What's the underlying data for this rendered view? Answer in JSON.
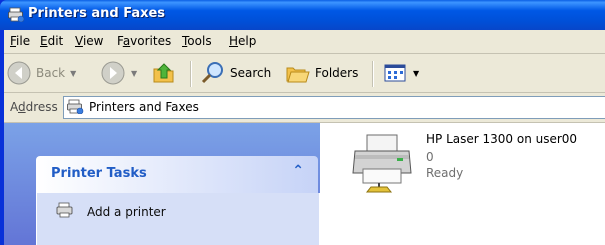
{
  "window": {
    "title": "Printers and Faxes"
  },
  "menu": [
    {
      "key": "F",
      "rest": "ile"
    },
    {
      "key": "E",
      "rest": "dit"
    },
    {
      "key": "V",
      "rest": "iew"
    },
    {
      "pre": "F",
      "key": "a",
      "rest": "vorites"
    },
    {
      "key": "T",
      "rest": "ools"
    },
    {
      "key": "H",
      "rest": "elp"
    }
  ],
  "toolbar": {
    "back_label": "Back",
    "search_label": "Search",
    "folders_label": "Folders"
  },
  "address": {
    "label_pre": "A",
    "label_key": "d",
    "label_rest": "dress",
    "value": "Printers and Faxes"
  },
  "tasks": {
    "title": "Printer Tasks",
    "chevron": "⌃",
    "items": [
      "Add a printer"
    ]
  },
  "printer": {
    "name": "HP Laser 1300 on user00",
    "jobs": "0",
    "status": "Ready"
  },
  "colors": {
    "title_bar": "#0058e6",
    "task_header_text": "#215dc6",
    "task_pane": "#7ba2e7"
  }
}
